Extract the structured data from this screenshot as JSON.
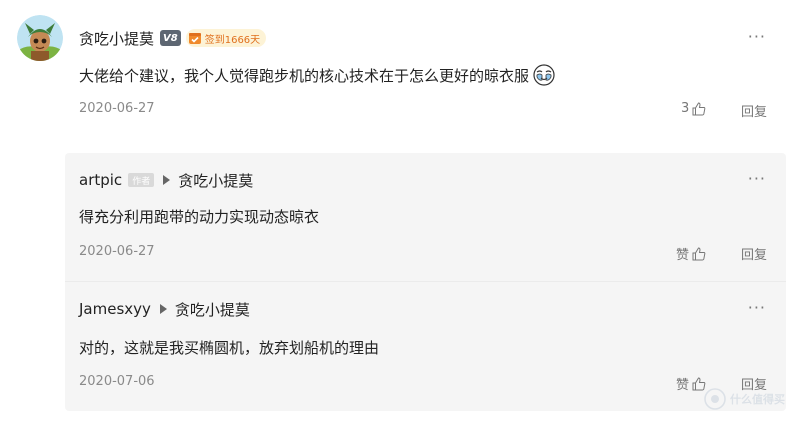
{
  "comment": {
    "author": "贪吃小提莫",
    "vip_level": "V8",
    "checkin_badge": "签到1666天",
    "text": "大佬给个建议，我个人觉得跑步机的核心技术在于怎么更好的晾衣服",
    "emoji": "sweat-laugh-emoji",
    "date": "2020-06-27",
    "like_count": "3",
    "reply_label": "回复",
    "more_label": "···"
  },
  "replies": [
    {
      "author": "artpic",
      "author_tag": "作者",
      "target": "贪吃小提莫",
      "text": "得充分利用跑带的动力实现动态晾衣",
      "date": "2020-06-27",
      "like_label": "赞",
      "reply_label": "回复",
      "more_label": "···"
    },
    {
      "author": "Jamesxyy",
      "target": "贪吃小提莫",
      "text": "对的，这就是我买椭圆机，放弃划船机的理由",
      "date": "2020-07-06",
      "like_label": "赞",
      "reply_label": "回复",
      "more_label": "···"
    }
  ],
  "watermark": {
    "text": "什么值得买",
    "icon": "watermark-logo-icon"
  },
  "colors": {
    "checkin_badge_bg": "#fdf3d6",
    "checkin_badge_text": "#e0701e",
    "vip_badge_bg": "#5d6672",
    "replies_bg": "#f5f5f5",
    "meta_text": "#8a8a8a"
  }
}
